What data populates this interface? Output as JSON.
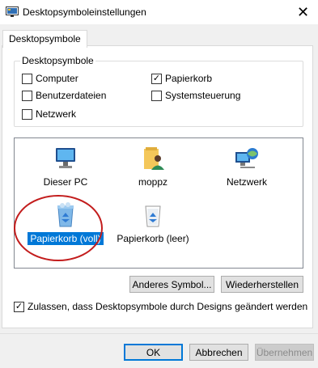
{
  "window": {
    "title": "Desktopsymboleinstellungen",
    "close_glyph": "✕"
  },
  "tabs": [
    {
      "label": "Desktopsymbole",
      "active": true
    }
  ],
  "desktop_icons_group": {
    "label": "Desktopsymbole",
    "checkboxes": [
      {
        "label": "Computer",
        "checked": false
      },
      {
        "label": "Papierkorb",
        "checked": true
      },
      {
        "label": "Benutzerdateien",
        "checked": false
      },
      {
        "label": "Systemsteuerung",
        "checked": false
      },
      {
        "label": "Netzwerk",
        "checked": false
      }
    ]
  },
  "icon_list": {
    "items": [
      {
        "label": "Dieser PC",
        "icon": "monitor-icon",
        "selected": false
      },
      {
        "label": "moppz",
        "icon": "user-folder-icon",
        "selected": false
      },
      {
        "label": "Netzwerk",
        "icon": "network-globe-icon",
        "selected": false
      },
      {
        "label": "Papierkorb (voll)",
        "icon": "recycle-bin-full-icon",
        "selected": true
      },
      {
        "label": "Papierkorb (leer)",
        "icon": "recycle-bin-empty-icon",
        "selected": false
      }
    ]
  },
  "actions": {
    "change_icon": "Anderes Symbol...",
    "restore": "Wiederherstellen"
  },
  "allow_themes": {
    "label": "Zulassen, dass Desktopsymbole durch Designs geändert werden",
    "checked": true
  },
  "footer": {
    "ok": "OK",
    "cancel": "Abbrechen",
    "apply": "Übernehmen",
    "apply_enabled": false
  },
  "colors": {
    "selection": "#0078d7",
    "annotation_ring": "#c31d1d"
  }
}
